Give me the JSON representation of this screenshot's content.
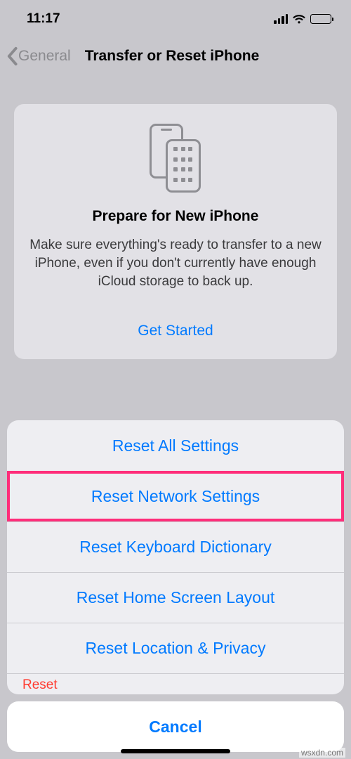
{
  "status": {
    "time": "11:17"
  },
  "nav": {
    "back_label": "General",
    "title": "Transfer or Reset iPhone"
  },
  "prepare_card": {
    "title": "Prepare for New iPhone",
    "description": "Make sure everything's ready to transfer to a new iPhone, even if you don't currently have enough iCloud storage to back up.",
    "cta": "Get Started"
  },
  "sheet": {
    "items": [
      "Reset All Settings",
      "Reset Network Settings",
      "Reset Keyboard Dictionary",
      "Reset Home Screen Layout",
      "Reset Location & Privacy"
    ],
    "peek": "Reset",
    "cancel": "Cancel"
  },
  "watermark": "wsxdn.com"
}
